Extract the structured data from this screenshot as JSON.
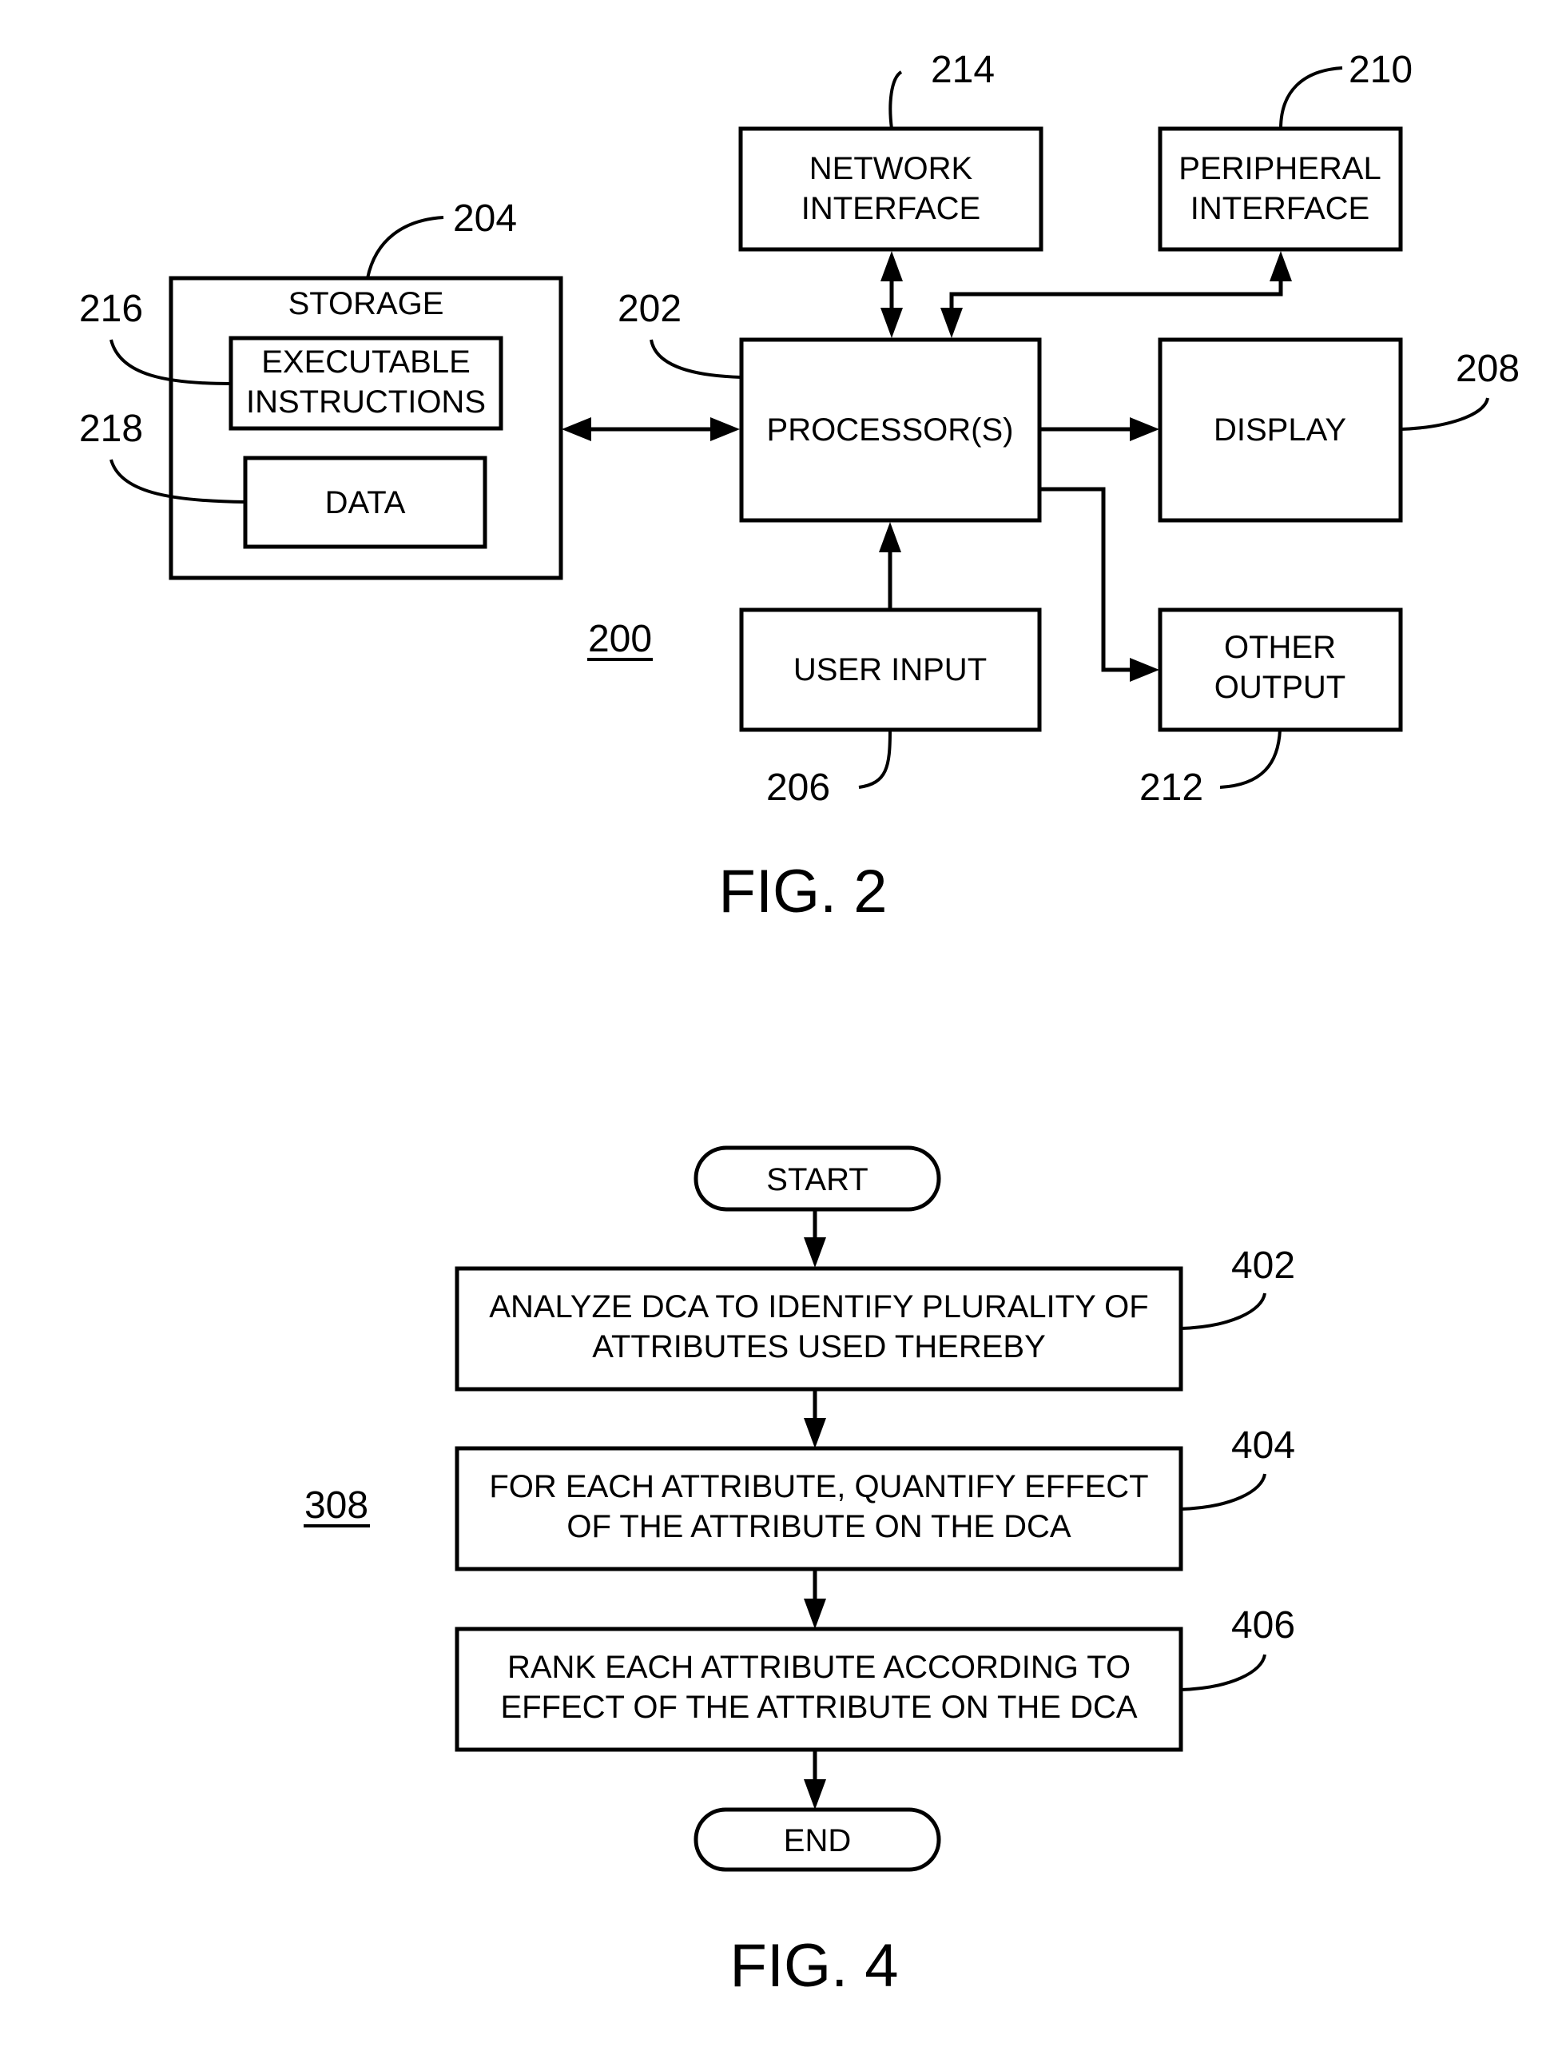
{
  "fig2": {
    "caption": "FIG. 2",
    "system_ref": "200",
    "storage": {
      "label": "STORAGE",
      "ref": "204"
    },
    "executable_instructions": {
      "line1": "EXECUTABLE",
      "line2": "INSTRUCTIONS",
      "ref": "216"
    },
    "data": {
      "label": "DATA",
      "ref": "218"
    },
    "processor": {
      "label": "PROCESSOR(S)",
      "ref": "202"
    },
    "network_interface": {
      "line1": "NETWORK",
      "line2": "INTERFACE",
      "ref": "214"
    },
    "peripheral_interface": {
      "line1": "PERIPHERAL",
      "line2": "INTERFACE",
      "ref": "210"
    },
    "display": {
      "label": "DISPLAY",
      "ref": "208"
    },
    "user_input": {
      "label": "USER INPUT",
      "ref": "206"
    },
    "other_output": {
      "line1": "OTHER",
      "line2": "OUTPUT",
      "ref": "212"
    }
  },
  "fig4": {
    "caption": "FIG. 4",
    "process_ref": "308",
    "start": "START",
    "end": "END",
    "steps": [
      {
        "line1": "ANALYZE DCA TO IDENTIFY PLURALITY OF",
        "line2": "ATTRIBUTES USED THEREBY",
        "ref": "402"
      },
      {
        "line1": "FOR EACH ATTRIBUTE, QUANTIFY EFFECT",
        "line2": "OF THE ATTRIBUTE ON THE DCA",
        "ref": "404"
      },
      {
        "line1": "RANK EACH ATTRIBUTE ACCORDING TO",
        "line2": "EFFECT OF THE ATTRIBUTE ON THE DCA",
        "ref": "406"
      }
    ]
  }
}
